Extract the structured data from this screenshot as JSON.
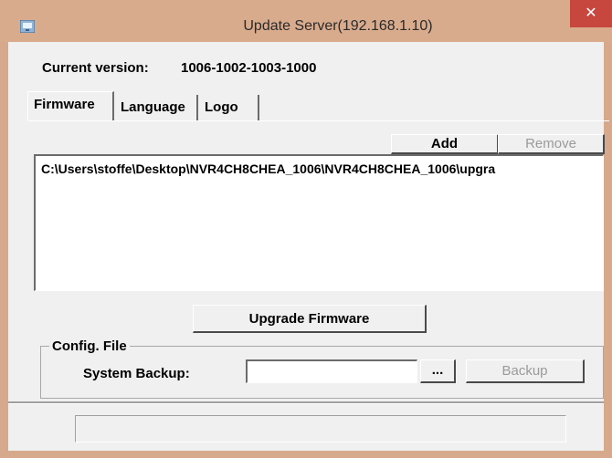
{
  "window": {
    "title": "Update Server(192.168.1.10)",
    "close_label": "✕"
  },
  "version": {
    "label": "Current version:",
    "value": "1006-1002-1003-1000"
  },
  "tabs": [
    {
      "label": "Firmware",
      "active": true
    },
    {
      "label": "Language",
      "active": false
    },
    {
      "label": "Logo",
      "active": false
    }
  ],
  "firmware": {
    "add_label": "Add",
    "remove_label": "Remove",
    "files": [
      "C:\\Users\\stoffe\\Desktop\\NVR4CH8CHEA_1006\\NVR4CH8CHEA_1006\\upgra"
    ],
    "upgrade_label": "Upgrade Firmware"
  },
  "config": {
    "group_label": "Config. File",
    "backup_label": "System Backup:",
    "path_value": "",
    "browse_label": "...",
    "backup_button_label": "Backup"
  },
  "status": {
    "text": ""
  }
}
